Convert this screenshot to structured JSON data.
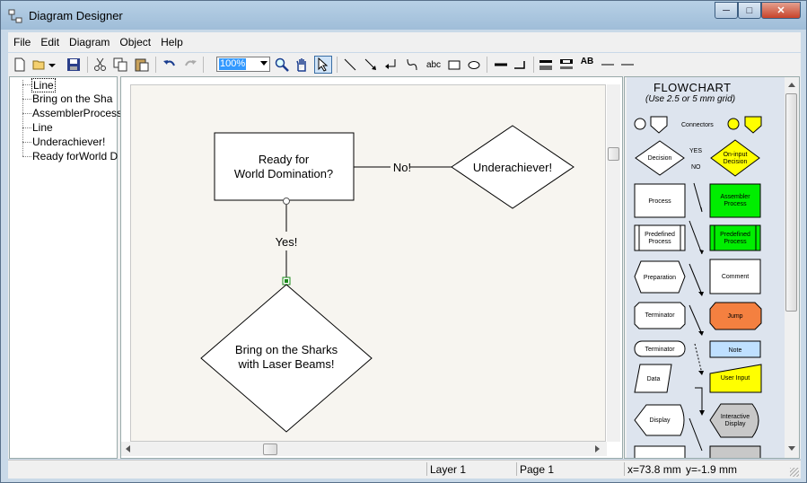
{
  "window": {
    "title": "Diagram Designer"
  },
  "caption": {
    "minimize": "─",
    "maximize": "□",
    "close": "✕"
  },
  "menu": [
    "File",
    "Edit",
    "Diagram",
    "Object",
    "Help"
  ],
  "toolbar": {
    "zoom": "100%",
    "text_tool": "abc",
    "ab_tool": "AB",
    "icons": [
      "new-file-icon",
      "open-folder-icon",
      "dropdown-arrow-icon",
      "save-icon",
      "cut-icon",
      "copy-icon",
      "paste-icon",
      "undo-icon",
      "redo-icon",
      "zoom-icon",
      "pan-hand-icon",
      "select-pointer-icon",
      "line-icon",
      "arrow-line-icon",
      "elbow-connector-icon",
      "curve-connector-icon",
      "text-icon",
      "rectangle-icon",
      "ellipse-icon",
      "line-width-icon",
      "line-end-icon",
      "bring-front-icon",
      "send-back-icon",
      "text-style-icon",
      "line-style-icon",
      "line-style-2-icon"
    ]
  },
  "tree": {
    "items": [
      {
        "label": "Line",
        "selected": true
      },
      {
        "label": "Bring on the Sha",
        "selected": false
      },
      {
        "label": "AssemblerProcess",
        "selected": false
      },
      {
        "label": "Line",
        "selected": false
      },
      {
        "label": "Underachiever!",
        "selected": false
      },
      {
        "label": "Ready forWorld D",
        "selected": false
      }
    ]
  },
  "diagram": {
    "box_line1": "Ready for",
    "box_line2": "World Domination?",
    "no_label": "No!",
    "yes_label": "Yes!",
    "right_diamond": "Underachiever!",
    "bottom_line1": "Bring on the Sharks",
    "bottom_line2": "with Laser Beams!"
  },
  "palette": {
    "title": "FLOWCHART",
    "subtitle": "(Use 2.5 or 5 mm grid)",
    "connectors": "Connectors",
    "decision": "Decision",
    "yes": "YES",
    "no": "NO",
    "on_input_1": "On-input",
    "on_input_2": "Decision",
    "process": "Process",
    "assembler_1": "Assembler",
    "assembler_2": "Process",
    "predefined_1": "Predefined",
    "predefined_2": "Process",
    "predefined_b1": "Predefined",
    "predefined_b2": "Process",
    "preparation": "Preparation",
    "comment": "Comment",
    "terminator": "Terminator",
    "jump": "Jump",
    "terminator2": "Terminator",
    "note": "Note",
    "data": "Data",
    "user_input": "User Input",
    "display": "Display",
    "interactive_1": "Interactive",
    "interactive_2": "Display",
    "colors": {
      "green": "#00ee00",
      "yellow": "#ffff00",
      "orange": "#f48040",
      "note_blue": "#bfe0ff",
      "gray": "#c8c8c8"
    }
  },
  "status": {
    "layer": "Layer 1",
    "page": "Page 1",
    "x": "x=73.8 mm",
    "y": "y=-1.9 mm"
  }
}
